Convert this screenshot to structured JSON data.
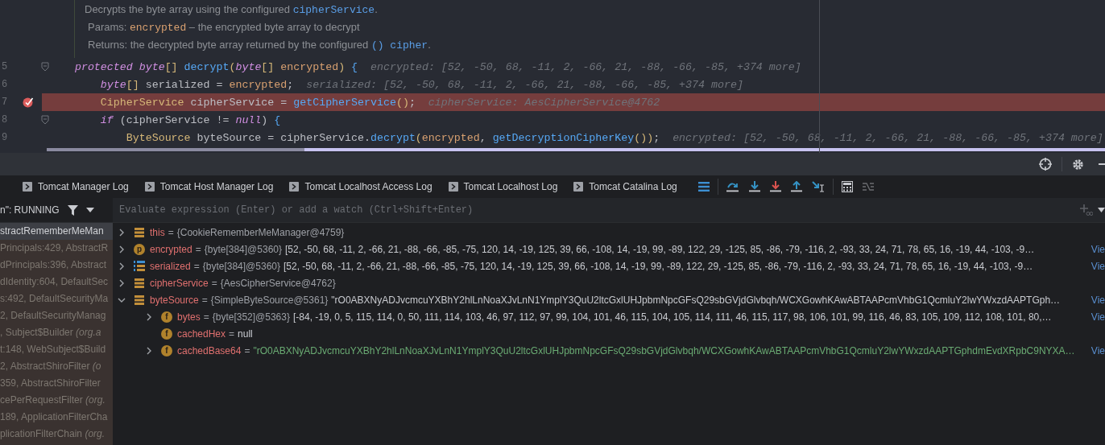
{
  "editor": {
    "doc": [
      [
        {
          "kind": "text",
          "text": "Decrypts the byte array using the configured "
        },
        {
          "kind": "link",
          "text": "cipherService"
        },
        {
          "kind": "text",
          "text": "."
        }
      ],
      [
        {
          "kind": "label",
          "text": "Params: "
        },
        {
          "kind": "param",
          "text": "encrypted"
        },
        {
          "kind": "text",
          "text": " – the encrypted byte array to decrypt"
        }
      ],
      [
        {
          "kind": "label",
          "text": "Returns: "
        },
        {
          "kind": "text",
          "text": "the decrypted byte array returned by the configured "
        },
        {
          "kind": "link",
          "text": "() cipher"
        },
        {
          "kind": "text",
          "text": "."
        }
      ]
    ],
    "lines": [
      {
        "number": "5",
        "breakpoint": false,
        "current": false,
        "fold": true,
        "tokens": [
          {
            "kind": "kw",
            "text": "    protected byte"
          },
          {
            "kind": "punct",
            "text": "[] "
          },
          {
            "kind": "method",
            "text": "decrypt"
          },
          {
            "kind": "punct",
            "text": "("
          },
          {
            "kind": "kw",
            "text": "byte"
          },
          {
            "kind": "punct",
            "text": "[] "
          },
          {
            "kind": "param",
            "text": "encrypted"
          },
          {
            "kind": "punct",
            "text": ") "
          },
          {
            "kind": "brace",
            "text": "{"
          }
        ],
        "hint": "encrypted: [52, -50, 68, -11, 2, -66, 21, -88, -66, -85, +374 more]"
      },
      {
        "number": "6",
        "breakpoint": false,
        "current": false,
        "fold": false,
        "tokens": [
          {
            "kind": "kw",
            "text": "        byte"
          },
          {
            "kind": "punct",
            "text": "[]"
          },
          {
            "kind": "plain",
            "text": " serialized = "
          },
          {
            "kind": "param",
            "text": "encrypted"
          },
          {
            "kind": "plain",
            "text": ";"
          }
        ],
        "hint": "serialized: [52, -50, 68, -11, 2, -66, 21, -88, -66, -85, +374 more]"
      },
      {
        "number": "7",
        "breakpoint": true,
        "current": true,
        "fold": false,
        "tokens": [
          {
            "kind": "type",
            "text": "        CipherService"
          },
          {
            "kind": "plain",
            "text": " cipherService = "
          },
          {
            "kind": "method",
            "text": "getCipherService"
          },
          {
            "kind": "punct",
            "text": "()"
          },
          {
            "kind": "plain",
            "text": ";"
          }
        ],
        "hint": "cipherService: AesCipherService@4762"
      },
      {
        "number": "8",
        "breakpoint": false,
        "current": false,
        "fold": true,
        "tokens": [
          {
            "kind": "kw",
            "text": "        if"
          },
          {
            "kind": "plain",
            "text": " (cipherService != "
          },
          {
            "kind": "kw",
            "text": "null"
          },
          {
            "kind": "plain",
            "text": ") "
          },
          {
            "kind": "brace",
            "text": "{"
          }
        ]
      },
      {
        "number": "9",
        "breakpoint": false,
        "current": false,
        "fold": false,
        "tokens": [
          {
            "kind": "type",
            "text": "            ByteSource"
          },
          {
            "kind": "plain",
            "text": " byteSource = cipherService."
          },
          {
            "kind": "method",
            "text": "decrypt"
          },
          {
            "kind": "punct",
            "text": "("
          },
          {
            "kind": "param",
            "text": "encrypted"
          },
          {
            "kind": "plain",
            "text": ", "
          },
          {
            "kind": "method",
            "text": "getDecryptionCipherKey"
          },
          {
            "kind": "punct",
            "text": "())"
          },
          {
            "kind": "plain",
            "text": ";"
          }
        ],
        "hint": "encrypted: [52, -50, 68, -11, 2, -66, 21, -88, -66, -85, +374 more]"
      }
    ]
  },
  "tabs": [
    {
      "label": "Tomcat Manager Log"
    },
    {
      "label": "Tomcat Host Manager Log"
    },
    {
      "label": "Tomcat Localhost Access Log"
    },
    {
      "label": "Tomcat Localhost Log"
    },
    {
      "label": "Tomcat Catalina Log"
    }
  ],
  "toolbar": [
    {
      "kind": "lines"
    },
    {
      "kind": "sep"
    },
    {
      "kind": "step-over"
    },
    {
      "kind": "step-into"
    },
    {
      "kind": "force-step-into"
    },
    {
      "kind": "step-out"
    },
    {
      "kind": "run-to-cursor"
    },
    {
      "kind": "sep"
    },
    {
      "kind": "evaluate"
    },
    {
      "kind": "trace",
      "disabled": true
    }
  ],
  "frames": {
    "thread": "n\": RUNNING",
    "items": [
      {
        "text": "stractRememberMeMan",
        "selected": true
      },
      {
        "text": "Principals:429, AbstractR",
        "selected": false
      },
      {
        "text": "dPrincipals:396, Abstract",
        "selected": false
      },
      {
        "text": "dIdentity:604, DefaultSec",
        "selected": false
      },
      {
        "text": "s:492, DefaultSecurityMa",
        "selected": false
      },
      {
        "text": "2, DefaultSecurityManag",
        "selected": false
      },
      {
        "text": ", Subject$Builder *(org.a*",
        "selected": false
      },
      {
        "text": "t:148, WebSubject$Build",
        "selected": false
      },
      {
        "text": "2, AbstractShiroFilter *(o*",
        "selected": false
      },
      {
        "text": "359, AbstractShiroFilter",
        "selected": false
      },
      {
        "text": "cePerRequestFilter *(org.*",
        "selected": false
      },
      {
        "text": "189, ApplicationFilterCha",
        "selected": false
      },
      {
        "text": "plicationFilterChain *(org.*",
        "selected": false
      }
    ]
  },
  "watch": {
    "placeholder": "Evaluate expression (Enter) or add a watch (Ctrl+Shift+Enter)"
  },
  "variables": [
    {
      "kind": "object",
      "name": "this",
      "equals": "=",
      "expanded": false,
      "type": "{CookieRememberMeManager@4759}"
    },
    {
      "kind": "param",
      "letter": "p",
      "name": "encrypted",
      "equals": "=",
      "expanded": false,
      "type": "{byte[384]@5360}",
      "value": "[52, -50, 68, -11, 2, -66, 21, -88, -66, -85, -75, 120, 14, -19, 125, 39, 66, -108, 14, -19, 99, -89, 122, 29, -125, 85, -86, -79, -116, 2, -93, 33, 24, 71, 78, 65, 16, -19, 44, -103, -9…",
      "view": "Vie"
    },
    {
      "kind": "array",
      "name": "serialized",
      "equals": "=",
      "expanded": false,
      "type": "{byte[384]@5360}",
      "value": "[52, -50, 68, -11, 2, -66, 21, -88, -66, -85, -75, 120, 14, -19, 125, 39, 66, -108, 14, -19, 99, -89, 122, 29, -125, 85, -86, -79, -116, 2, -93, 33, 24, 71, 78, 65, 16, -19, 44, -103, -9…",
      "view": "Vie"
    },
    {
      "kind": "object",
      "name": "cipherService",
      "equals": "=",
      "expanded": false,
      "type": "{AesCipherService@4762}"
    },
    {
      "kind": "object",
      "name": "byteSource",
      "equals": "=",
      "expanded": true,
      "type": "{SimpleByteSource@5361}",
      "value": "\"rO0ABXNyADJvcmcuYXBhY2hlLnNoaXJvLnN1YmplY3QuU2ltcGxlUHJpbmNpcGFsQ29sbGVjdGlvbqh/WCXGowhKAwABTAAPcmVhbG1QcmluY2lwYWxzdAAPTGph…",
      "view": "Vie",
      "children": [
        {
          "kind": "field",
          "letter": "f",
          "name": "bytes",
          "equals": "=",
          "expanded": false,
          "type": "{byte[352]@5363}",
          "value": "[-84, -19, 0, 5, 115, 114, 0, 50, 111, 114, 103, 46, 97, 112, 97, 99, 104, 101, 46, 115, 104, 105, 114, 111, 46, 115, 117, 98, 106, 101, 99, 116, 46, 83, 105, 109, 112, 108, 101, 80,…",
          "view": "Vie"
        },
        {
          "kind": "field",
          "letter": "f",
          "name": "cachedHex",
          "equals": "=",
          "value": "null"
        },
        {
          "kind": "string-field",
          "letter": "f",
          "name": "cachedBase64",
          "equals": "=",
          "expanded": false,
          "value": "\"rO0ABXNyADJvcmcuYXBhY2hlLnNoaXJvLnN1YmplY3QuU2ltcGxlUHJpbmNpcGFsQ29sbGVjdGlvbqh/WCXGowhKAwABTAAPcmVhbG1QcmluY2lwYWxzdAAPTGphdmEvdXRpbC9NYXA…",
          "view": "Vie"
        }
      ]
    }
  ]
}
